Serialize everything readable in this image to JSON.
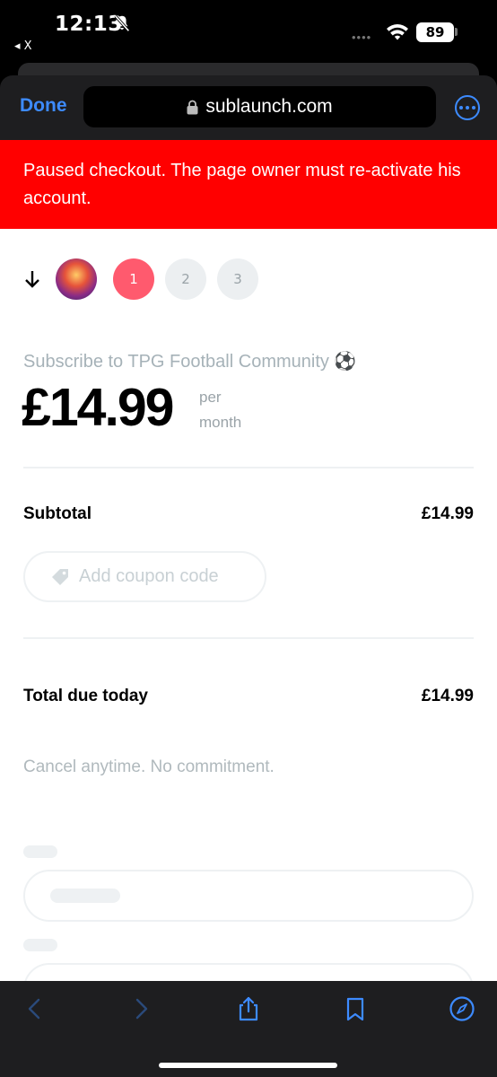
{
  "status_bar": {
    "time": "12:13",
    "back_app_label": "◂ X",
    "signal_dots": "••••",
    "battery": "89"
  },
  "browser": {
    "done_label": "Done",
    "url": "sublaunch.com"
  },
  "banner": {
    "text": "Paused checkout. The page owner must re-activate his account.",
    "color": "#ff0000"
  },
  "checkout": {
    "steps": [
      "1",
      "2",
      "3"
    ],
    "active_step": 1,
    "title": "Subscribe to TPG Football Community ⚽",
    "price": "£14.99",
    "per_line1": "per",
    "per_line2": "month",
    "subtotal_label": "Subtotal",
    "subtotal_value": "£14.99",
    "coupon_label": "Add coupon code",
    "total_label": "Total due today",
    "total_value": "£14.99",
    "cancel_note": "Cancel anytime. No commitment."
  },
  "colors": {
    "accent": "#3d8bff",
    "active_step": "#ff5a6e"
  }
}
